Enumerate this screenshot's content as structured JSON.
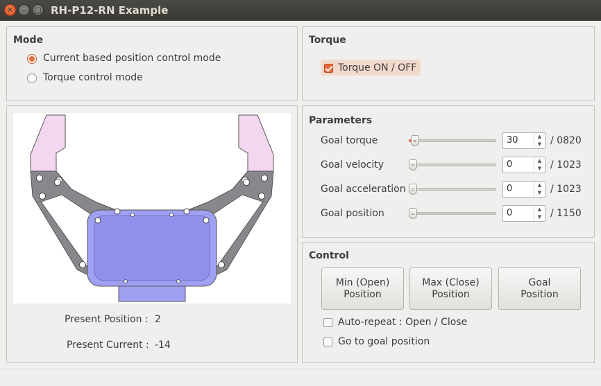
{
  "window": {
    "title": "RH-P12-RN Example"
  },
  "mode": {
    "title": "Mode",
    "options": [
      {
        "label": "Current based position control mode",
        "selected": true
      },
      {
        "label": "Torque control mode",
        "selected": false
      }
    ]
  },
  "torque": {
    "title": "Torque",
    "checkbox_label": "Torque ON / OFF",
    "checked": true
  },
  "status": {
    "present_position_label": "Present Position :",
    "present_position_value": "2",
    "present_current_label": "Present Current :",
    "present_current_value": "-14"
  },
  "parameters": {
    "title": "Parameters",
    "rows": [
      {
        "label": "Goal torque",
        "value": "30",
        "max": "/ 0820",
        "fraction": 0.037
      },
      {
        "label": "Goal velocity",
        "value": "0",
        "max": "/ 1023",
        "fraction": 0
      },
      {
        "label": "Goal acceleration",
        "value": "0",
        "max": "/ 1023",
        "fraction": 0
      },
      {
        "label": "Goal position",
        "value": "0",
        "max": "/ 1150",
        "fraction": 0
      }
    ]
  },
  "control": {
    "title": "Control",
    "buttons": [
      {
        "label": "Min (Open)\nPosition"
      },
      {
        "label": "Max (Close)\nPosition"
      },
      {
        "label": "Goal\nPosition"
      }
    ],
    "options": [
      {
        "label": "Auto-repeat : Open / Close",
        "checked": false
      },
      {
        "label": "Go to goal position",
        "checked": false
      }
    ]
  },
  "colors": {
    "accent": "#e8693a",
    "gripper_body": "#9fa0f2",
    "gripper_arm": "#87878c",
    "gripper_finger": "#f3d6f0"
  }
}
